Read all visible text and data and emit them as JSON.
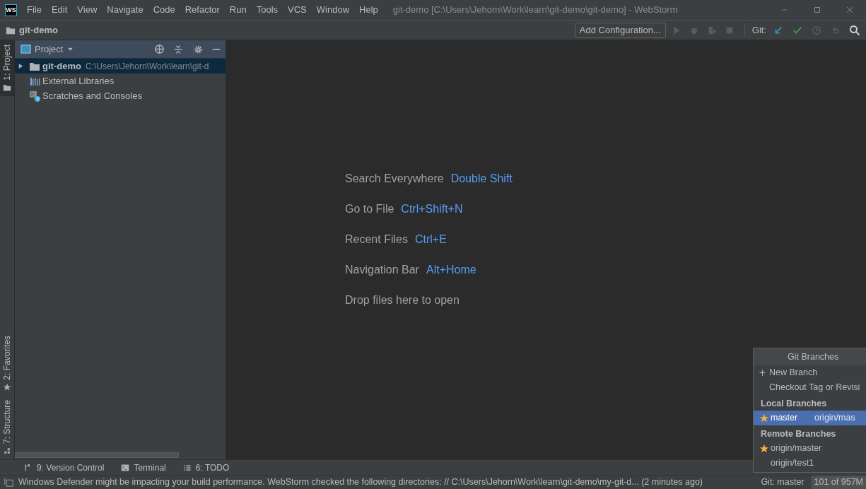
{
  "window": {
    "title": "git-demo [C:\\Users\\Jehorn\\Work\\learn\\git-demo\\git-demo] - WebStorm",
    "logo": "WS"
  },
  "menu": [
    "File",
    "Edit",
    "View",
    "Navigate",
    "Code",
    "Refactor",
    "Run",
    "Tools",
    "VCS",
    "Window",
    "Help"
  ],
  "nav_bar": {
    "project": "git-demo",
    "run_config": "Add Configuration...",
    "git_label": "Git:"
  },
  "left_stripe": [
    {
      "label": "1: Project",
      "selected": true,
      "kind": "folder"
    },
    {
      "label": "2: Favorites",
      "selected": false,
      "kind": "star"
    },
    {
      "label": "7: Structure",
      "selected": false,
      "kind": "structure"
    }
  ],
  "project_panel": {
    "title": "Project",
    "tree": [
      {
        "label": "git-demo",
        "path": "C:\\Users\\Jehorn\\Work\\learn\\git-d",
        "kind": "folder",
        "selected": true,
        "expanded": false
      },
      {
        "label": "External Libraries",
        "kind": "libraries",
        "selected": false
      },
      {
        "label": "Scratches and Consoles",
        "kind": "scratches",
        "selected": false
      }
    ]
  },
  "editor_hints": [
    {
      "label": "Search Everywhere",
      "shortcut": "Double Shift"
    },
    {
      "label": "Go to File",
      "shortcut": "Ctrl+Shift+N"
    },
    {
      "label": "Recent Files",
      "shortcut": "Ctrl+E"
    },
    {
      "label": "Navigation Bar",
      "shortcut": "Alt+Home"
    },
    {
      "label": "Drop files here to open"
    }
  ],
  "tool_tabs": [
    {
      "label": "9: Version Control",
      "kind": "vcs"
    },
    {
      "label": "Terminal",
      "kind": "terminal"
    },
    {
      "label": "6: TODO",
      "kind": "todo"
    }
  ],
  "git_branches_popup": {
    "title": "Git Branches",
    "actions": [
      {
        "label": "New Branch",
        "kind": "plus"
      },
      {
        "label": "Checkout Tag or Revisi",
        "kind": "plain"
      }
    ],
    "sections": [
      {
        "title": "Local Branches",
        "branches": [
          {
            "name": "master",
            "tracking": "origin/mas",
            "favorite": true,
            "selected": true
          }
        ]
      },
      {
        "title": "Remote Branches",
        "branches": [
          {
            "name": "origin/master",
            "favorite": true,
            "selected": false
          },
          {
            "name": "origin/test1",
            "favorite": false,
            "selected": false
          }
        ]
      }
    ]
  },
  "status_bar": {
    "message": "Windows Defender might be impacting your build performance. WebStorm checked the following directories: // C:\\Users\\Jehorn\\Work\\learn\\git-demo\\my-git-d... (2 minutes ago)",
    "branch": "Git: master",
    "memory": "101 of 957M"
  }
}
